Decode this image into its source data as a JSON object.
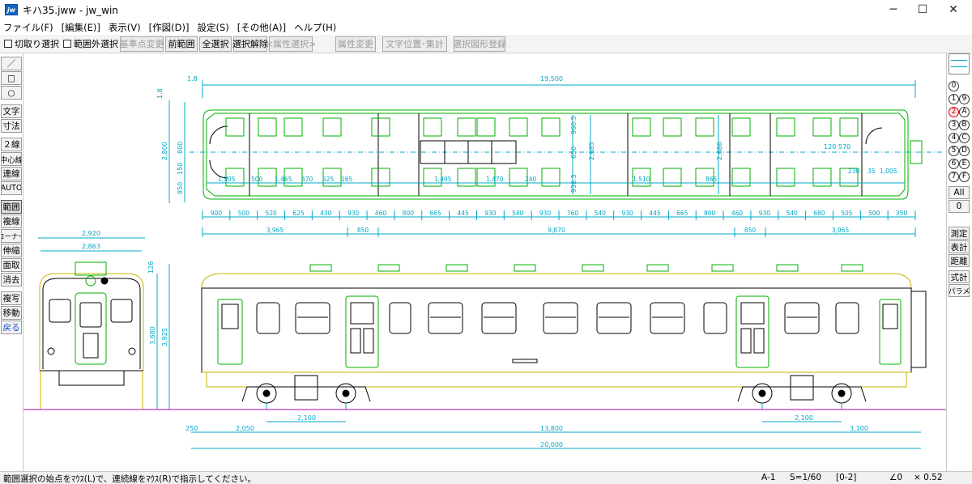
{
  "window": {
    "title": "キハ35.jww - jw_win",
    "icon": "jw-app-icon",
    "minimize": "─",
    "maximize": "☐",
    "close": "✕"
  },
  "menu": [
    "ファイル(F)",
    "[編集(E)]",
    "表示(V)",
    "[作図(D)]",
    "設定(S)",
    "[その他(A)]",
    "ヘルプ(H)"
  ],
  "toolbar": {
    "check1": "切取り選択",
    "check2": "範囲外選択",
    "buttons": [
      {
        "label": "基準点変更",
        "enabled": false
      },
      {
        "label": "前範囲",
        "enabled": true
      },
      {
        "label": "全選択",
        "enabled": true
      },
      {
        "label": "選択解除",
        "enabled": true
      },
      {
        "label": "<属性選択>",
        "enabled": false
      },
      {
        "label": "属性変更",
        "enabled": false
      },
      {
        "label": "文字位置･集計",
        "enabled": false
      },
      {
        "label": "選択図形登録",
        "enabled": false
      }
    ]
  },
  "left_tools": [
    "／",
    "□",
    "○",
    "文字",
    "寸法",
    "２線",
    "中心線",
    "連線",
    "AUTO",
    "範囲",
    "複線",
    "コーナー",
    "伸縮",
    "面取",
    "消去",
    "複写",
    "移動",
    "戻る"
  ],
  "right_palette": {
    "layer_groups": [
      [
        "0",
        ""
      ],
      [
        "1",
        "9"
      ],
      [
        "2",
        "A"
      ],
      [
        "3",
        "B"
      ],
      [
        "4",
        "C"
      ],
      [
        "5",
        "D"
      ],
      [
        "6",
        "E"
      ],
      [
        "7",
        "F"
      ]
    ],
    "all_label": "All",
    "zero_label": "0",
    "tools": [
      "測定",
      "表計",
      "距離",
      "式計",
      "パラメ"
    ]
  },
  "drawing": {
    "plan_dims_top": [
      "1.8",
      "19,500"
    ],
    "plan_dims_left": [
      "1.8",
      "2,800",
      "150",
      "800",
      "850"
    ],
    "plan_inner": [
      "960.5",
      "650",
      "2,685",
      "2,686",
      "938.5",
      "120",
      "570",
      "1,305",
      "500",
      "1,465",
      "470",
      "525",
      "165",
      "1,495",
      "1,470",
      "240",
      "1,510",
      "865",
      "1,005",
      "35",
      "230"
    ],
    "plan_bottom_row1": [
      "900",
      "500",
      "520",
      "625",
      "430",
      "930",
      "460",
      "800",
      "665",
      "445",
      "930",
      "540",
      "930",
      "760",
      "540",
      "930",
      "445",
      "665",
      "800",
      "460",
      "930",
      "540",
      "680",
      "505",
      "500",
      "350"
    ],
    "plan_bottom_row2": [
      "3,965",
      "850",
      "9,870",
      "850",
      "3,965"
    ],
    "front_dims": [
      "2,920",
      "2,863",
      "3,680",
      "3,925",
      "126"
    ],
    "side_dims": [
      "250",
      "2,050",
      "2,100",
      "13,800",
      "2,100",
      "3,100",
      "20,000"
    ]
  },
  "status": {
    "message": "範囲選択の始点をﾏｳｽ(L)で、連続線をﾏｳｽ(R)で指示してください。",
    "paper": "A-1",
    "scale": "S=1/60",
    "layer": "[0-2]",
    "angle": "∠0",
    "zoom": "× 0.52"
  },
  "colors": {
    "green": "#00b000",
    "cyan": "#00a8c8",
    "magenta": "#b000b0",
    "yellow": "#c8b400",
    "black": "#000000"
  }
}
